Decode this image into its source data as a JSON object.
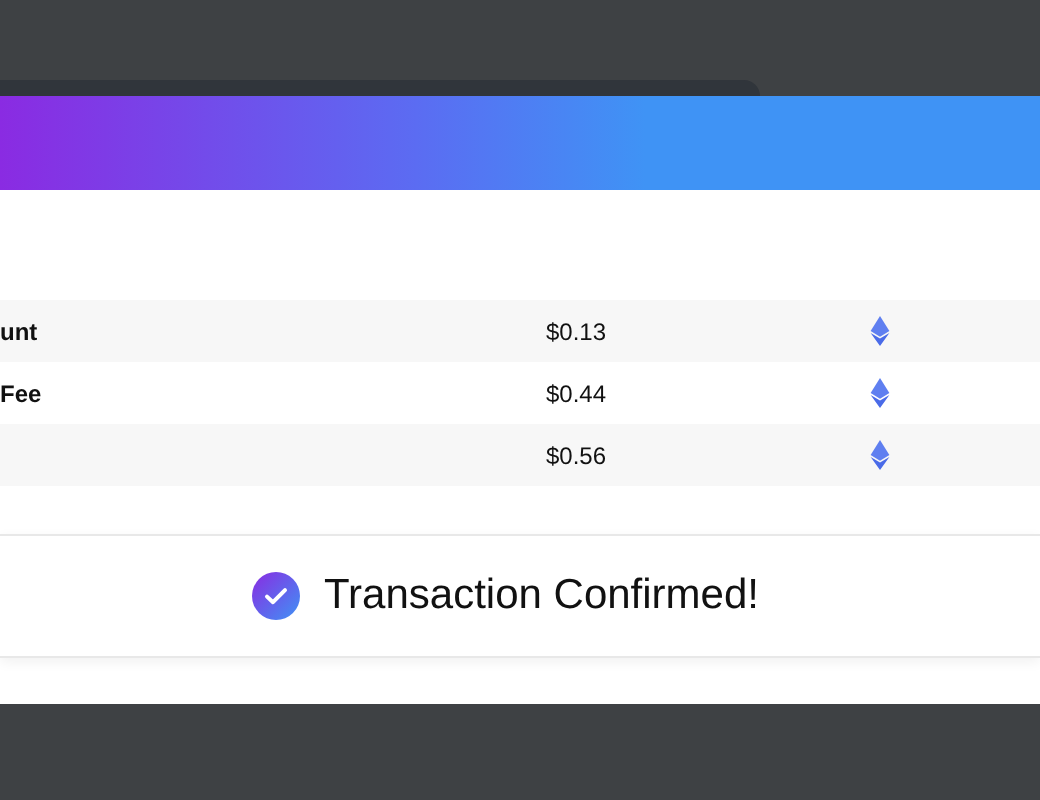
{
  "fee_table": {
    "rows": [
      {
        "label": "unt",
        "price": "$0.13"
      },
      {
        "label": "Fee",
        "price": "$0.44"
      },
      {
        "price": "$0.56"
      }
    ]
  },
  "confirmation": {
    "message": "Transaction Confirmed!"
  }
}
